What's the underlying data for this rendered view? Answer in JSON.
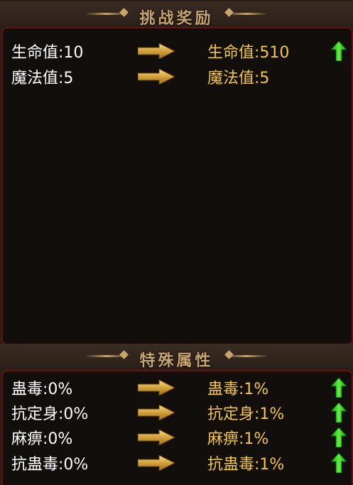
{
  "challenge_reward": {
    "title": "挑战奖励",
    "rows": [
      {
        "left": "生命值:10",
        "right": "生命值:510",
        "increased": true
      },
      {
        "left": "魔法值:5",
        "right": "魔法值:5",
        "increased": false
      }
    ]
  },
  "special_attributes": {
    "title": "特殊属性",
    "rows": [
      {
        "left": "蛊毒:0%",
        "right": "蛊毒:1%",
        "increased": true
      },
      {
        "left": "抗定身:0%",
        "right": "抗定身:1%",
        "increased": true
      },
      {
        "left": "麻痹:0%",
        "right": "麻痹:1%",
        "increased": true
      },
      {
        "left": "抗蛊毒:0%",
        "right": "抗蛊毒:1%",
        "increased": true
      }
    ]
  },
  "colors": {
    "accent_gold": "#c8a56a",
    "value_yellow": "#f2c640",
    "increase_green": "#2ecc1f",
    "panel_border": "#5a1514"
  },
  "icons": {
    "transition": "arrow-right-icon",
    "increase": "arrow-up-icon"
  }
}
